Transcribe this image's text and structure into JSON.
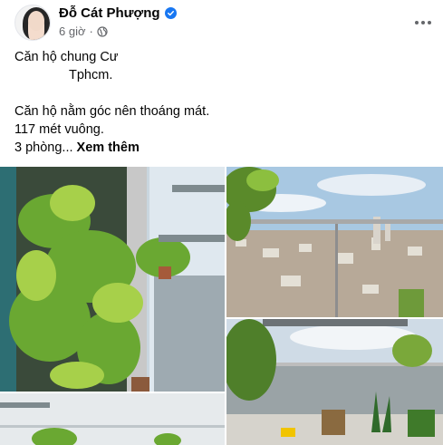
{
  "post": {
    "author": "Đỗ Cát Phượng",
    "verified": true,
    "time": "6 giờ",
    "separator": "·",
    "privacy_icon": "globe-icon",
    "more_icon": "more-options-icon",
    "text_lines": [
      "Căn hộ chung Cư",
      "Tphcm.",
      "",
      "Căn hộ nằm góc nên thoáng mát.",
      "117 mét vuông.",
      "3 phòng..."
    ],
    "see_more": "Xem thêm",
    "photos": [
      {
        "subject": "vertical-garden-ferns"
      },
      {
        "subject": "balcony-city-view-fern"
      },
      {
        "subject": "balcony-plants-city-view"
      },
      {
        "subject": "balcony-rail-plants"
      }
    ]
  },
  "colors": {
    "brand_blue": "#1877f2",
    "secondary_text": "#65676b",
    "primary_text": "#050505"
  }
}
